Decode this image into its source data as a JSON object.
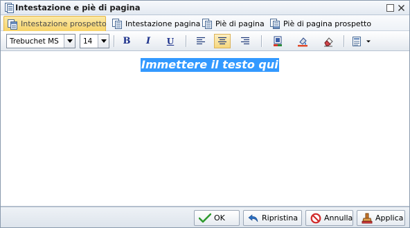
{
  "window": {
    "title": "Intestazione e piè di pagina",
    "icon": "document-icon",
    "maximize_icon": "maximize-icon",
    "close_icon": "close-icon"
  },
  "tabs": [
    {
      "label": "Intestazione prospetto",
      "icon": "report-header-icon",
      "active": true
    },
    {
      "label": "Intestazione pagina",
      "icon": "page-header-icon",
      "active": false
    },
    {
      "label": "Piè di pagina",
      "icon": "page-footer-icon",
      "active": false
    },
    {
      "label": "Piè di pagina prospetto",
      "icon": "report-footer-icon",
      "active": false
    }
  ],
  "toolbar": {
    "font_family": "Trebuchet MS",
    "font_size": "14",
    "bold_label": "B",
    "italic_label": "I",
    "underline_label": "U",
    "center_pressed": true
  },
  "editor": {
    "text": "Immettere il testo qui",
    "selection_color": "#3399ff"
  },
  "footer": {
    "ok_label": "OK",
    "reset_label": "Ripristina",
    "cancel_label": "Annulla",
    "apply_label": "Applica"
  },
  "colors": {
    "active_tab": "#f7d46a",
    "accent": "#1a2f8a"
  }
}
